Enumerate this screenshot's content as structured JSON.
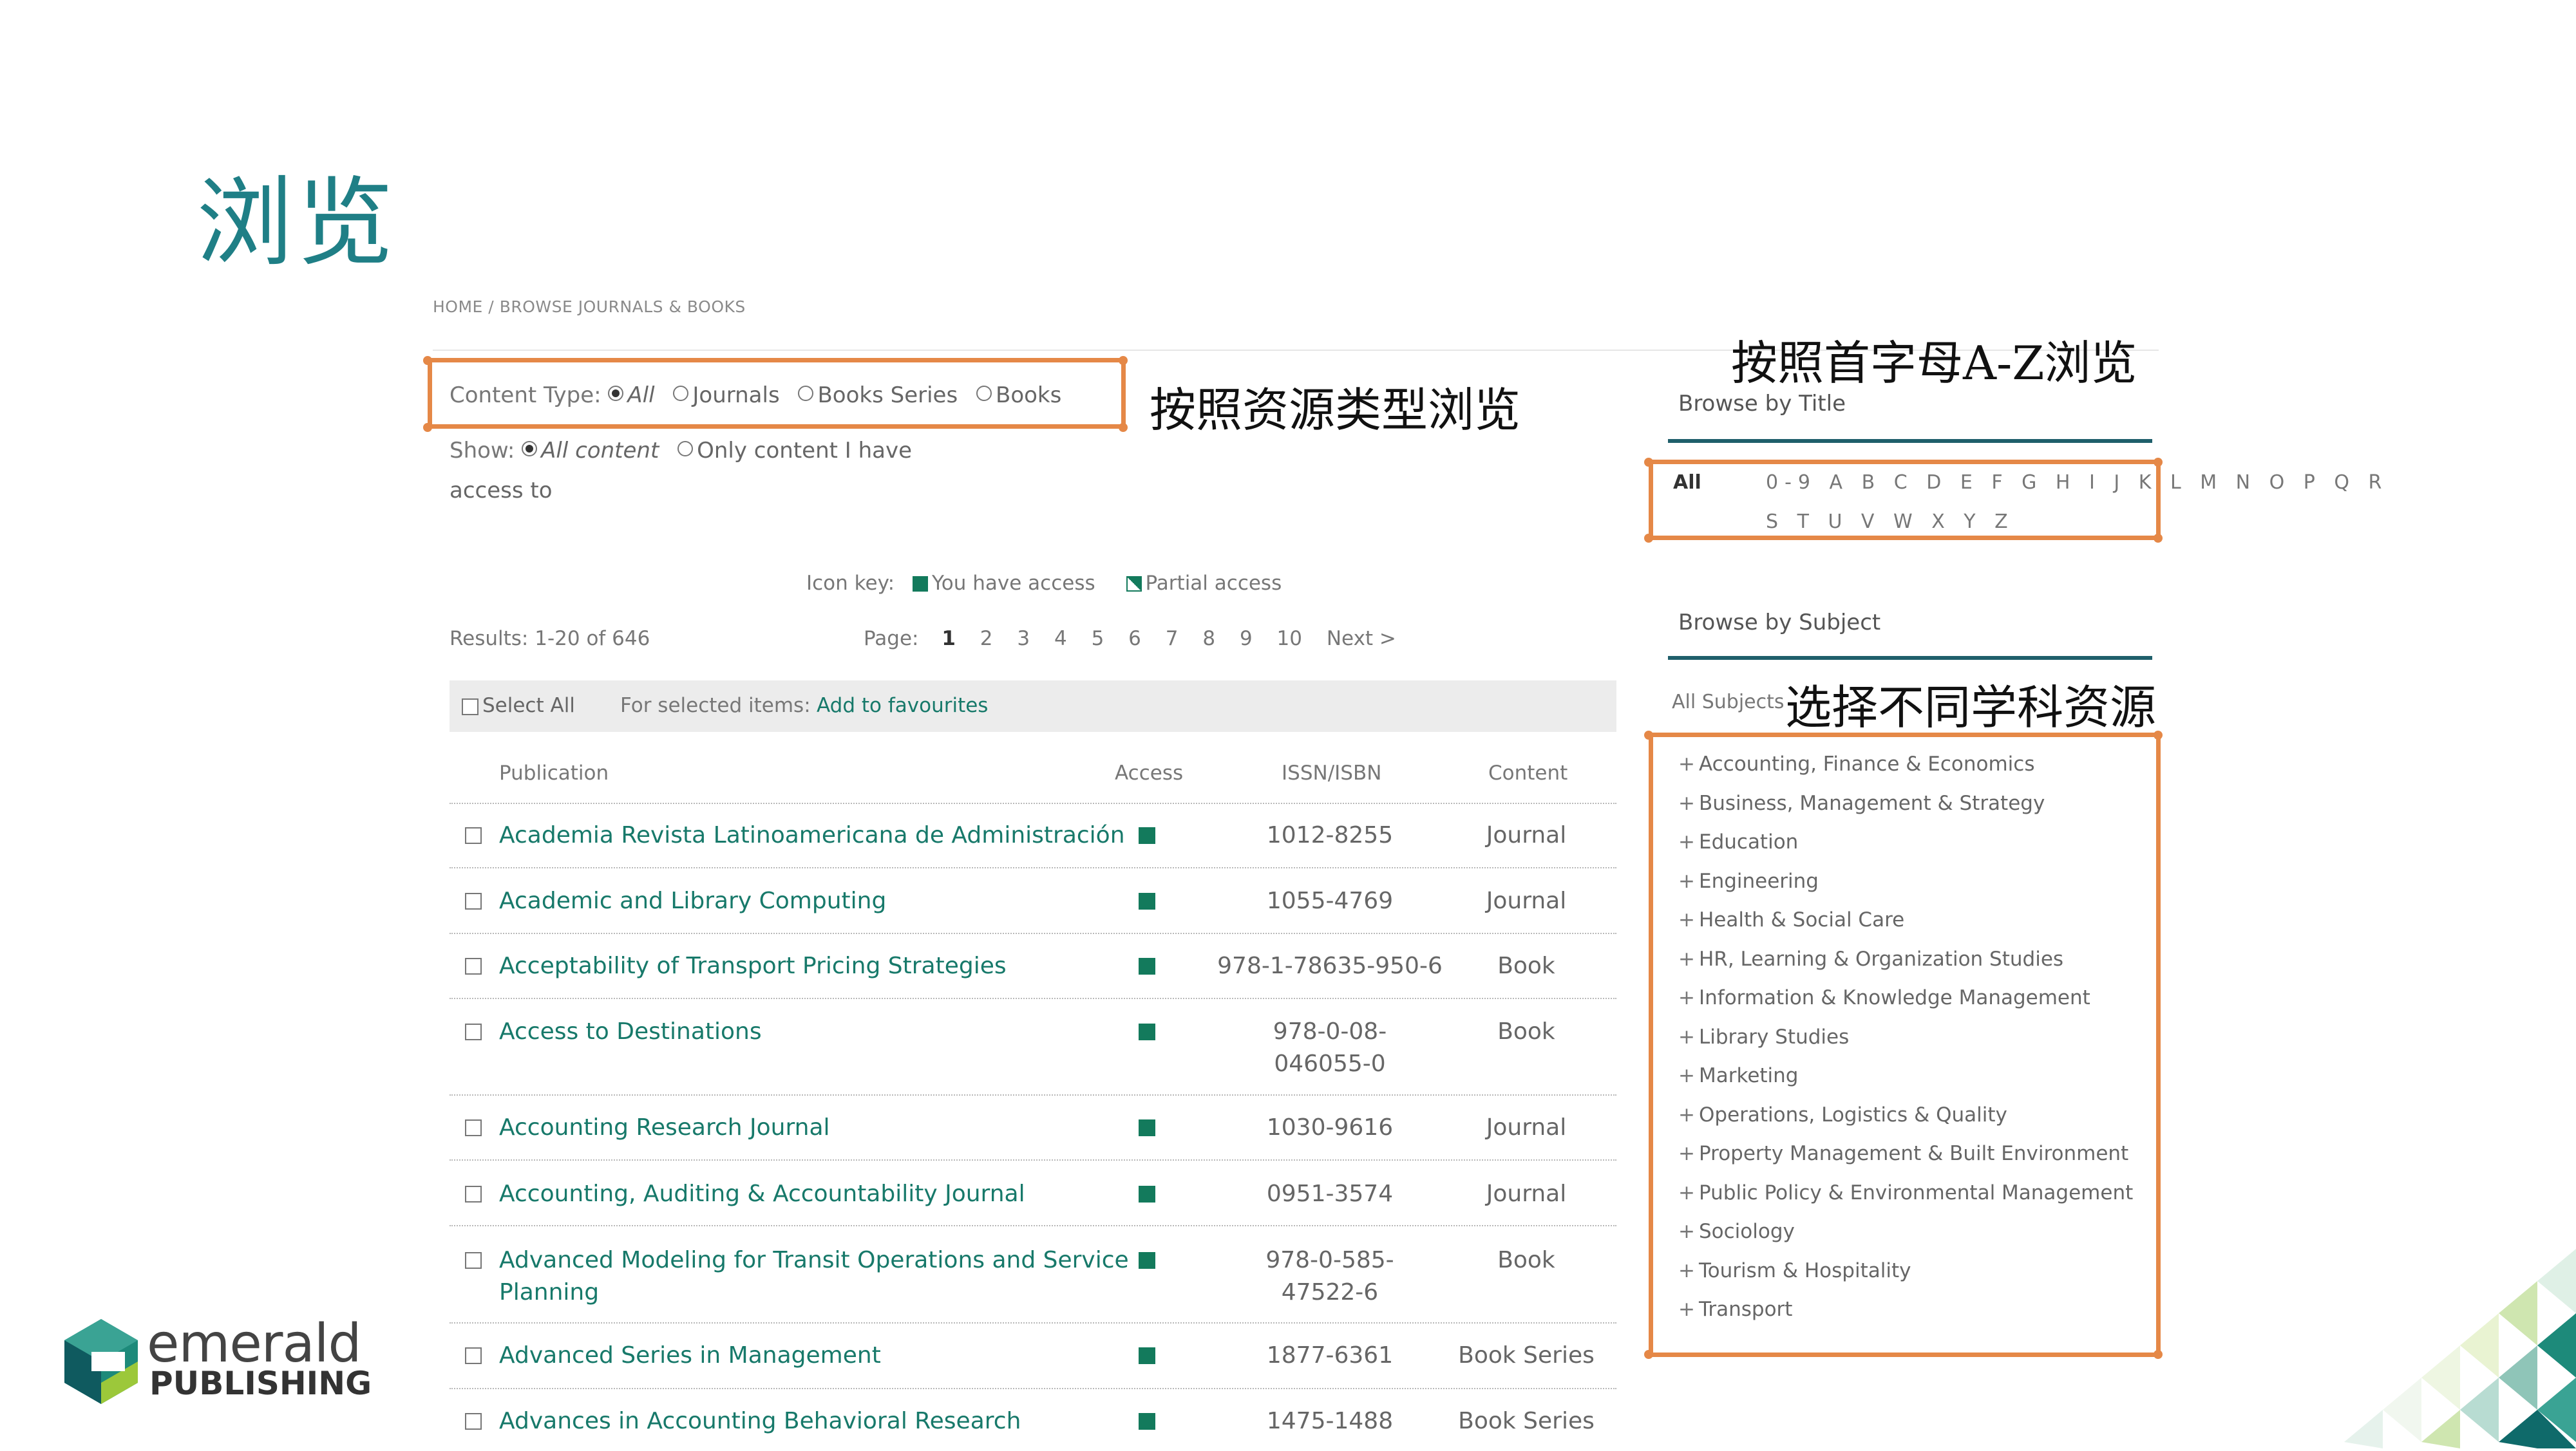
{
  "slide": {
    "title": "浏览"
  },
  "breadcrumb": {
    "home": "HOME",
    "separator": "/",
    "current": "BROWSE JOURNALS & BOOKS"
  },
  "content_type": {
    "label": "Content Type:",
    "options": [
      {
        "label": "All",
        "checked": true
      },
      {
        "label": "Journals",
        "checked": false
      },
      {
        "label": "Books Series",
        "checked": false
      },
      {
        "label": "Books",
        "checked": false
      }
    ]
  },
  "show": {
    "label": "Show:",
    "options": [
      {
        "label": "All content",
        "checked": true
      },
      {
        "label": "Only content I have",
        "checked": false
      }
    ],
    "wrap": "access to"
  },
  "annotations": {
    "by_type": "按照资源类型浏览",
    "by_letter": "按照首字母A-Z浏览",
    "by_subject": "选择不同学科资源"
  },
  "icon_key": {
    "label": "Icon key:",
    "full": "You have access",
    "partial": "Partial access"
  },
  "results": {
    "text": "Results: 1-20 of 646"
  },
  "pagination": {
    "label": "Page:",
    "pages": [
      "1",
      "2",
      "3",
      "4",
      "5",
      "6",
      "7",
      "8",
      "9",
      "10"
    ],
    "current": "1",
    "next": "Next >"
  },
  "toolbar": {
    "select_all": "Select All",
    "for_selected": "For selected items:",
    "add_fav": "Add to favourites"
  },
  "table": {
    "headers": {
      "publication": "Publication",
      "access": "Access",
      "issn": "ISSN/ISBN",
      "content": "Content"
    },
    "rows": [
      {
        "title": "Academia Revista Latinoamericana de Administración",
        "title2": "",
        "issn": "1012-8255",
        "issn2": "",
        "content": "Journal"
      },
      {
        "title": "Academic and Library Computing",
        "title2": "",
        "issn": "1055-4769",
        "issn2": "",
        "content": "Journal"
      },
      {
        "title": "Acceptability of Transport Pricing Strategies",
        "title2": "",
        "issn": "978-1-78635-950-6",
        "issn2": "",
        "content": "Book"
      },
      {
        "title": "Access to Destinations",
        "title2": "",
        "issn": "978-0-08-",
        "issn2": "046055-0",
        "content": "Book"
      },
      {
        "title": "Accounting Research Journal",
        "title2": "",
        "issn": "1030-9616",
        "issn2": "",
        "content": "Journal"
      },
      {
        "title": "Accounting, Auditing & Accountability Journal",
        "title2": "",
        "issn": "0951-3574",
        "issn2": "",
        "content": "Journal"
      },
      {
        "title": "Advanced Modeling for Transit Operations and Service",
        "title2": "Planning",
        "issn": "978-0-585-",
        "issn2": "47522-6",
        "content": "Book"
      },
      {
        "title": "Advanced Series in Management",
        "title2": "",
        "issn": "1877-6361",
        "issn2": "",
        "content": "Book Series"
      },
      {
        "title": "Advances in Accounting Behavioral Research",
        "title2": "",
        "issn": "1475-1488",
        "issn2": "",
        "content": "Book Series"
      }
    ]
  },
  "browse_title": {
    "heading": "Browse by Title",
    "all": "All",
    "letters_row1": "0-9 A B C D E F G H I J K L M N O P Q R",
    "letters_row2": "S T U V W X Y Z"
  },
  "browse_subject": {
    "heading": "Browse by Subject",
    "all": "All Subjects",
    "plus": "+",
    "items": [
      "Accounting, Finance & Economics",
      "Business, Management & Strategy",
      "Education",
      "Engineering",
      "Health & Social Care",
      "HR, Learning & Organization Studies",
      "Information & Knowledge Management",
      "Library Studies",
      "Marketing",
      "Operations, Logistics & Quality",
      "Property Management & Built Environment",
      "Public Policy & Environmental Management",
      "Sociology",
      "Tourism & Hospitality",
      "Transport"
    ]
  },
  "logo": {
    "word1": "emerald",
    "word2": "PUBLISHING"
  },
  "colors": {
    "accent_orange": "#e58847",
    "teal_title": "#1f7f86",
    "access_green": "#137a5c",
    "link_teal": "#17796a"
  }
}
